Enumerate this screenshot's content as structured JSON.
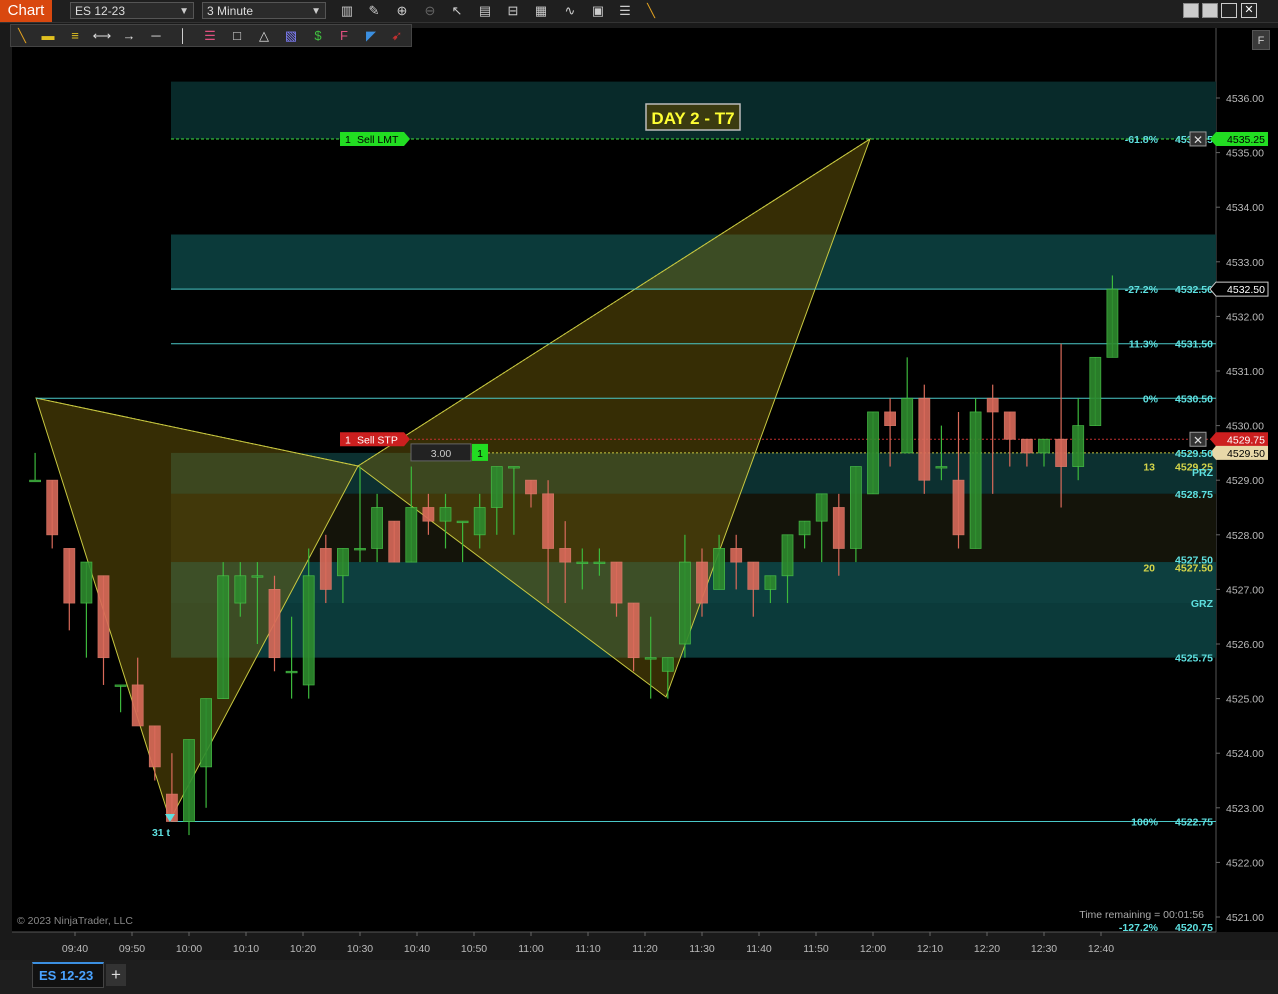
{
  "app": {
    "title": "Chart"
  },
  "toolbar": {
    "instrument": "ES 12-23",
    "interval": "3 Minute",
    "f_button": "F"
  },
  "tab": {
    "label": "ES 12-23",
    "add_label": "+"
  },
  "colors": {
    "up": "#2e8b2e",
    "down": "#d96a5a",
    "pattern_fill": "#4a4010",
    "zone": "#0a3a3a",
    "cyan": "#5ee0e0",
    "yellow": "#d4d44a"
  },
  "chart_data": {
    "type": "candlestick",
    "ylim": [
      4520.75,
      4536.6
    ],
    "y_ticks": [
      "4521.00",
      "4522.00",
      "4523.00",
      "4524.00",
      "4525.00",
      "4526.00",
      "4527.00",
      "4528.00",
      "4529.00",
      "4530.00",
      "4531.00",
      "4532.00",
      "4533.00",
      "4534.00",
      "4535.00",
      "4536.00"
    ],
    "x_ticks": [
      "09:40",
      "09:50",
      "10:00",
      "10:10",
      "10:20",
      "10:30",
      "10:40",
      "10:50",
      "11:00",
      "11:10",
      "11:20",
      "11:30",
      "11:40",
      "11:50",
      "12:00",
      "12:10",
      "12:20",
      "12:30",
      "12:40"
    ],
    "candles": [
      [
        "09:33",
        4529.0,
        4529.5,
        4529.0,
        4529.0
      ],
      [
        "09:36",
        4529.0,
        4529.0,
        4527.75,
        4528.0
      ],
      [
        "09:39",
        4527.75,
        4527.75,
        4526.25,
        4526.75
      ],
      [
        "09:42",
        4526.75,
        4527.5,
        4525.75,
        4527.5
      ],
      [
        "09:45",
        4527.25,
        4527.25,
        4525.25,
        4525.75
      ],
      [
        "09:48",
        4525.25,
        4525.25,
        4524.75,
        4525.25
      ],
      [
        "09:51",
        4525.25,
        4525.75,
        4524.75,
        4524.5
      ],
      [
        "09:54",
        4524.5,
        4524.5,
        4523.5,
        4523.75
      ],
      [
        "09:57",
        4523.25,
        4524.0,
        4522.75,
        4522.75
      ],
      [
        "10:00",
        4522.75,
        4524.25,
        4522.5,
        4524.25
      ],
      [
        "10:03",
        4523.75,
        4525.0,
        4523.0,
        4525.0
      ],
      [
        "10:06",
        4525.0,
        4527.5,
        4525.0,
        4527.25
      ],
      [
        "10:09",
        4526.75,
        4527.5,
        4526.5,
        4527.25
      ],
      [
        "10:12",
        4527.25,
        4527.5,
        4526.0,
        4527.25
      ],
      [
        "10:15",
        4527.0,
        4527.25,
        4525.5,
        4525.75
      ],
      [
        "10:18",
        4525.5,
        4526.5,
        4525.0,
        4525.5
      ],
      [
        "10:21",
        4525.25,
        4527.75,
        4525.0,
        4527.25
      ],
      [
        "10:24",
        4527.75,
        4528.0,
        4526.75,
        4527.0
      ],
      [
        "10:27",
        4527.25,
        4527.75,
        4526.75,
        4527.75
      ],
      [
        "10:30",
        4527.75,
        4529.25,
        4527.5,
        4527.75
      ],
      [
        "10:33",
        4527.75,
        4528.75,
        4527.5,
        4528.5
      ],
      [
        "10:36",
        4528.25,
        4528.25,
        4527.5,
        4527.5
      ],
      [
        "10:39",
        4527.5,
        4529.25,
        4527.5,
        4528.5
      ],
      [
        "10:42",
        4528.5,
        4528.75,
        4528.0,
        4528.25
      ],
      [
        "10:45",
        4528.25,
        4528.75,
        4527.75,
        4528.5
      ],
      [
        "10:48",
        4528.25,
        4528.25,
        4527.5,
        4528.25
      ],
      [
        "10:51",
        4528.0,
        4528.75,
        4527.75,
        4528.5
      ],
      [
        "10:54",
        4528.5,
        4529.25,
        4528.0,
        4529.25
      ],
      [
        "10:57",
        4529.25,
        4529.25,
        4528.0,
        4529.25
      ],
      [
        "11:00",
        4529.0,
        4529.0,
        4528.5,
        4528.75
      ],
      [
        "11:03",
        4528.75,
        4529.0,
        4526.75,
        4527.75
      ],
      [
        "11:06",
        4527.75,
        4528.25,
        4526.75,
        4527.5
      ],
      [
        "11:09",
        4527.5,
        4527.75,
        4527.0,
        4527.5
      ],
      [
        "11:12",
        4527.5,
        4527.75,
        4527.25,
        4527.5
      ],
      [
        "11:15",
        4527.5,
        4527.5,
        4526.5,
        4526.75
      ],
      [
        "11:18",
        4526.75,
        4526.75,
        4525.5,
        4525.75
      ],
      [
        "11:21",
        4525.75,
        4526.5,
        4525.0,
        4525.75
      ],
      [
        "11:24",
        4525.5,
        4525.75,
        4525.0,
        4525.75
      ],
      [
        "11:27",
        4526.0,
        4528.0,
        4525.75,
        4527.5
      ],
      [
        "11:30",
        4527.5,
        4527.75,
        4526.5,
        4526.75
      ],
      [
        "11:33",
        4527.0,
        4528.0,
        4527.0,
        4527.75
      ],
      [
        "11:36",
        4527.75,
        4528.0,
        4527.0,
        4527.5
      ],
      [
        "11:39",
        4527.5,
        4527.5,
        4526.5,
        4527.0
      ],
      [
        "11:42",
        4527.0,
        4527.25,
        4526.75,
        4527.25
      ],
      [
        "11:45",
        4527.25,
        4528.0,
        4526.75,
        4528.0
      ],
      [
        "11:48",
        4528.0,
        4528.25,
        4527.75,
        4528.25
      ],
      [
        "11:51",
        4528.25,
        4528.75,
        4527.5,
        4528.75
      ],
      [
        "11:54",
        4528.5,
        4528.75,
        4527.25,
        4527.75
      ],
      [
        "11:57",
        4527.75,
        4529.25,
        4527.5,
        4529.25
      ],
      [
        "12:00",
        4528.75,
        4530.25,
        4528.75,
        4530.25
      ],
      [
        "12:03",
        4530.25,
        4530.5,
        4529.25,
        4530.0
      ],
      [
        "12:06",
        4529.5,
        4531.25,
        4529.5,
        4530.5
      ],
      [
        "12:09",
        4530.5,
        4530.75,
        4528.75,
        4529.0
      ],
      [
        "12:12",
        4529.25,
        4530.0,
        4529.0,
        4529.25
      ],
      [
        "12:15",
        4529.0,
        4530.25,
        4527.75,
        4528.0
      ],
      [
        "12:18",
        4527.75,
        4530.5,
        4527.75,
        4530.25
      ],
      [
        "12:21",
        4530.5,
        4530.75,
        4528.75,
        4530.25
      ],
      [
        "12:24",
        4530.25,
        4530.25,
        4529.25,
        4529.75
      ],
      [
        "12:27",
        4529.75,
        4529.75,
        4529.25,
        4529.5
      ],
      [
        "12:30",
        4529.5,
        4529.75,
        4529.25,
        4529.75
      ],
      [
        "12:33",
        4529.75,
        4531.5,
        4528.5,
        4529.25
      ],
      [
        "12:36",
        4529.25,
        4530.5,
        4529.0,
        4530.0
      ],
      [
        "12:39",
        4530.0,
        4531.25,
        4530.0,
        4531.25
      ],
      [
        "12:42",
        4531.25,
        4532.75,
        4531.25,
        4532.5
      ]
    ]
  },
  "annotations": {
    "title_label": "DAY 2 - T7",
    "copyright": "© 2023 NinjaTrader, LLC",
    "time_remaining": "Time remaining = 00:01:56",
    "pivot_label": "31 t",
    "orders": [
      {
        "qty": "1",
        "label": "Sell LMT",
        "price": "4535.25"
      },
      {
        "qty": "1",
        "label": "Sell STP",
        "price": "4529.75"
      }
    ],
    "order_qty_box": "3.00",
    "order_qty_badge": "1",
    "price_markers": [
      {
        "text": "4535.25",
        "price": 4535.25
      },
      {
        "text": "4532.50",
        "price": 4532.5
      },
      {
        "text": "4529.75",
        "price": 4529.75
      },
      {
        "text": "4529.50",
        "price": 4529.5
      }
    ],
    "fib_levels": [
      {
        "pct": "-61.8%",
        "price_text": "4535.25",
        "price": 4535.25
      },
      {
        "pct": "-27.2%",
        "price_text": "4532.50",
        "price": 4532.5
      },
      {
        "pct": "11.3%",
        "price_text": "4531.50",
        "price": 4531.5
      },
      {
        "pct": "0%",
        "price_text": "4530.50",
        "price": 4530.5
      },
      {
        "pct": "100%",
        "price_text": "4522.75",
        "price": 4522.75
      }
    ],
    "zone_labels": [
      {
        "text": "13",
        "price": 4529.25
      },
      {
        "text": "4529.25",
        "price": 4529.25
      },
      {
        "text": "PRZ",
        "price": 4529.15
      },
      {
        "text": "4529.50",
        "price": 4529.5
      },
      {
        "text": "4528.75",
        "price": 4528.75
      },
      {
        "text": "20",
        "price": 4527.4
      },
      {
        "text": "4527.50",
        "price": 4527.4
      },
      {
        "text": "4527.50",
        "price": 4527.55
      },
      {
        "text": "GRZ",
        "price": 4526.75
      },
      {
        "text": "4525.75",
        "price": 4525.75
      }
    ],
    "footer_cut_labels": [
      {
        "text": "-127.2%",
        "price": 4520.6
      },
      {
        "text": "4520.75",
        "price": 4520.6
      }
    ]
  }
}
